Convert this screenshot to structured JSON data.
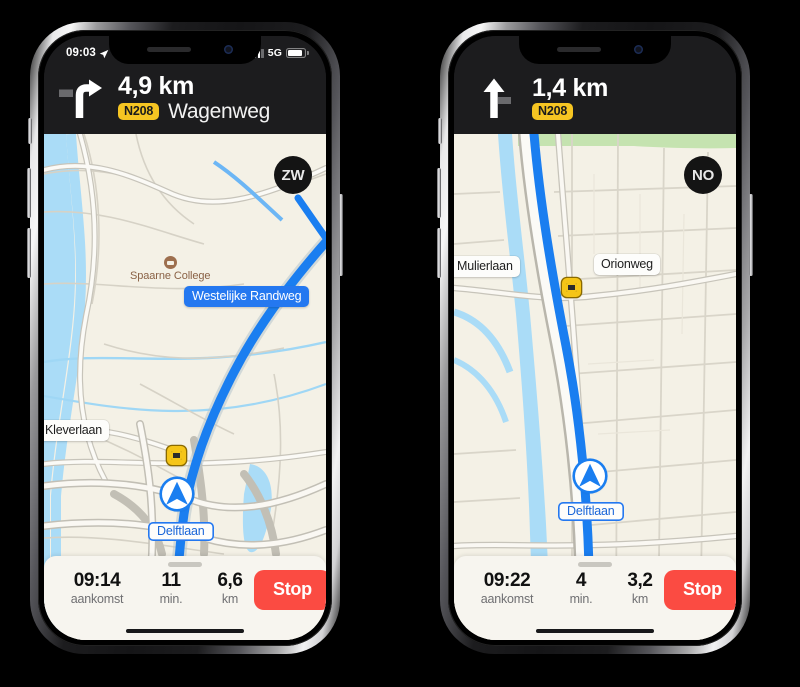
{
  "scene": {
    "background_color": "#000000",
    "description": "Two iPhone screenshots side by side showing Apple Maps turn-by-turn navigation in Dutch"
  },
  "colors": {
    "banner_bg": "#1c1c1e",
    "map_bg": "#f4f1e6",
    "route_blue": "#1a7ef0",
    "shield_yellow": "#f6c522",
    "stop_red": "#fb4b42",
    "sheet_bg": "#f7f5ef",
    "water_blue": "#9ed7f5",
    "park_green": "#c5e3b0",
    "poi_brown": "#8a6246"
  },
  "phones": [
    {
      "id": "phone-left",
      "statusbar": {
        "visible": true,
        "time": "09:03",
        "location_icon": "location-arrow-icon",
        "signal_icon": "cellular-bars-icon",
        "network": "5G",
        "battery_icon": "battery-icon"
      },
      "banner": {
        "maneuver_icon": "turn-right-icon",
        "distance": "4,9 km",
        "shield": "N208",
        "road_name": "Wagenweg"
      },
      "map": {
        "compass": "ZW",
        "labels": [
          {
            "name": "westelijke-randweg",
            "text": "Westelijke Randweg",
            "style": "blue"
          },
          {
            "name": "kleverlaan",
            "text": "Kleverlaan",
            "style": "white"
          },
          {
            "name": "delftlaan",
            "text": "Delftlaan",
            "style": "outline"
          }
        ],
        "poi": {
          "name": "spaarne-college",
          "text": "Spaarne College",
          "icon": "school-icon"
        },
        "speed_camera_icon": "speed-camera-icon",
        "location_puck_icon": "navigation-arrow-icon"
      },
      "sheet": {
        "eta_value": "09:14",
        "eta_label": "aankomst",
        "minutes_value": "11",
        "minutes_label": "min.",
        "distance_value": "6,6",
        "distance_label": "km",
        "stop_label": "Stop"
      }
    },
    {
      "id": "phone-right",
      "statusbar": {
        "visible": false,
        "time": "",
        "location_icon": "location-arrow-icon",
        "signal_icon": "cellular-bars-icon",
        "network": "",
        "battery_icon": "battery-icon"
      },
      "banner": {
        "maneuver_icon": "continue-straight-icon",
        "distance": "1,4 km",
        "shield": "N208",
        "road_name": ""
      },
      "map": {
        "compass": "NO",
        "labels": [
          {
            "name": "mulierlaan",
            "text": "n Mulierlaan",
            "style": "white"
          },
          {
            "name": "orionweg",
            "text": "Orionweg",
            "style": "white"
          },
          {
            "name": "delftlaan",
            "text": "Delftlaan",
            "style": "outline"
          }
        ],
        "speed_camera_icon": "speed-camera-icon",
        "location_puck_icon": "navigation-arrow-icon"
      },
      "sheet": {
        "eta_value": "09:22",
        "eta_label": "aankomst",
        "minutes_value": "4",
        "minutes_label": "min.",
        "distance_value": "3,2",
        "distance_label": "km",
        "stop_label": "Stop"
      }
    }
  ]
}
